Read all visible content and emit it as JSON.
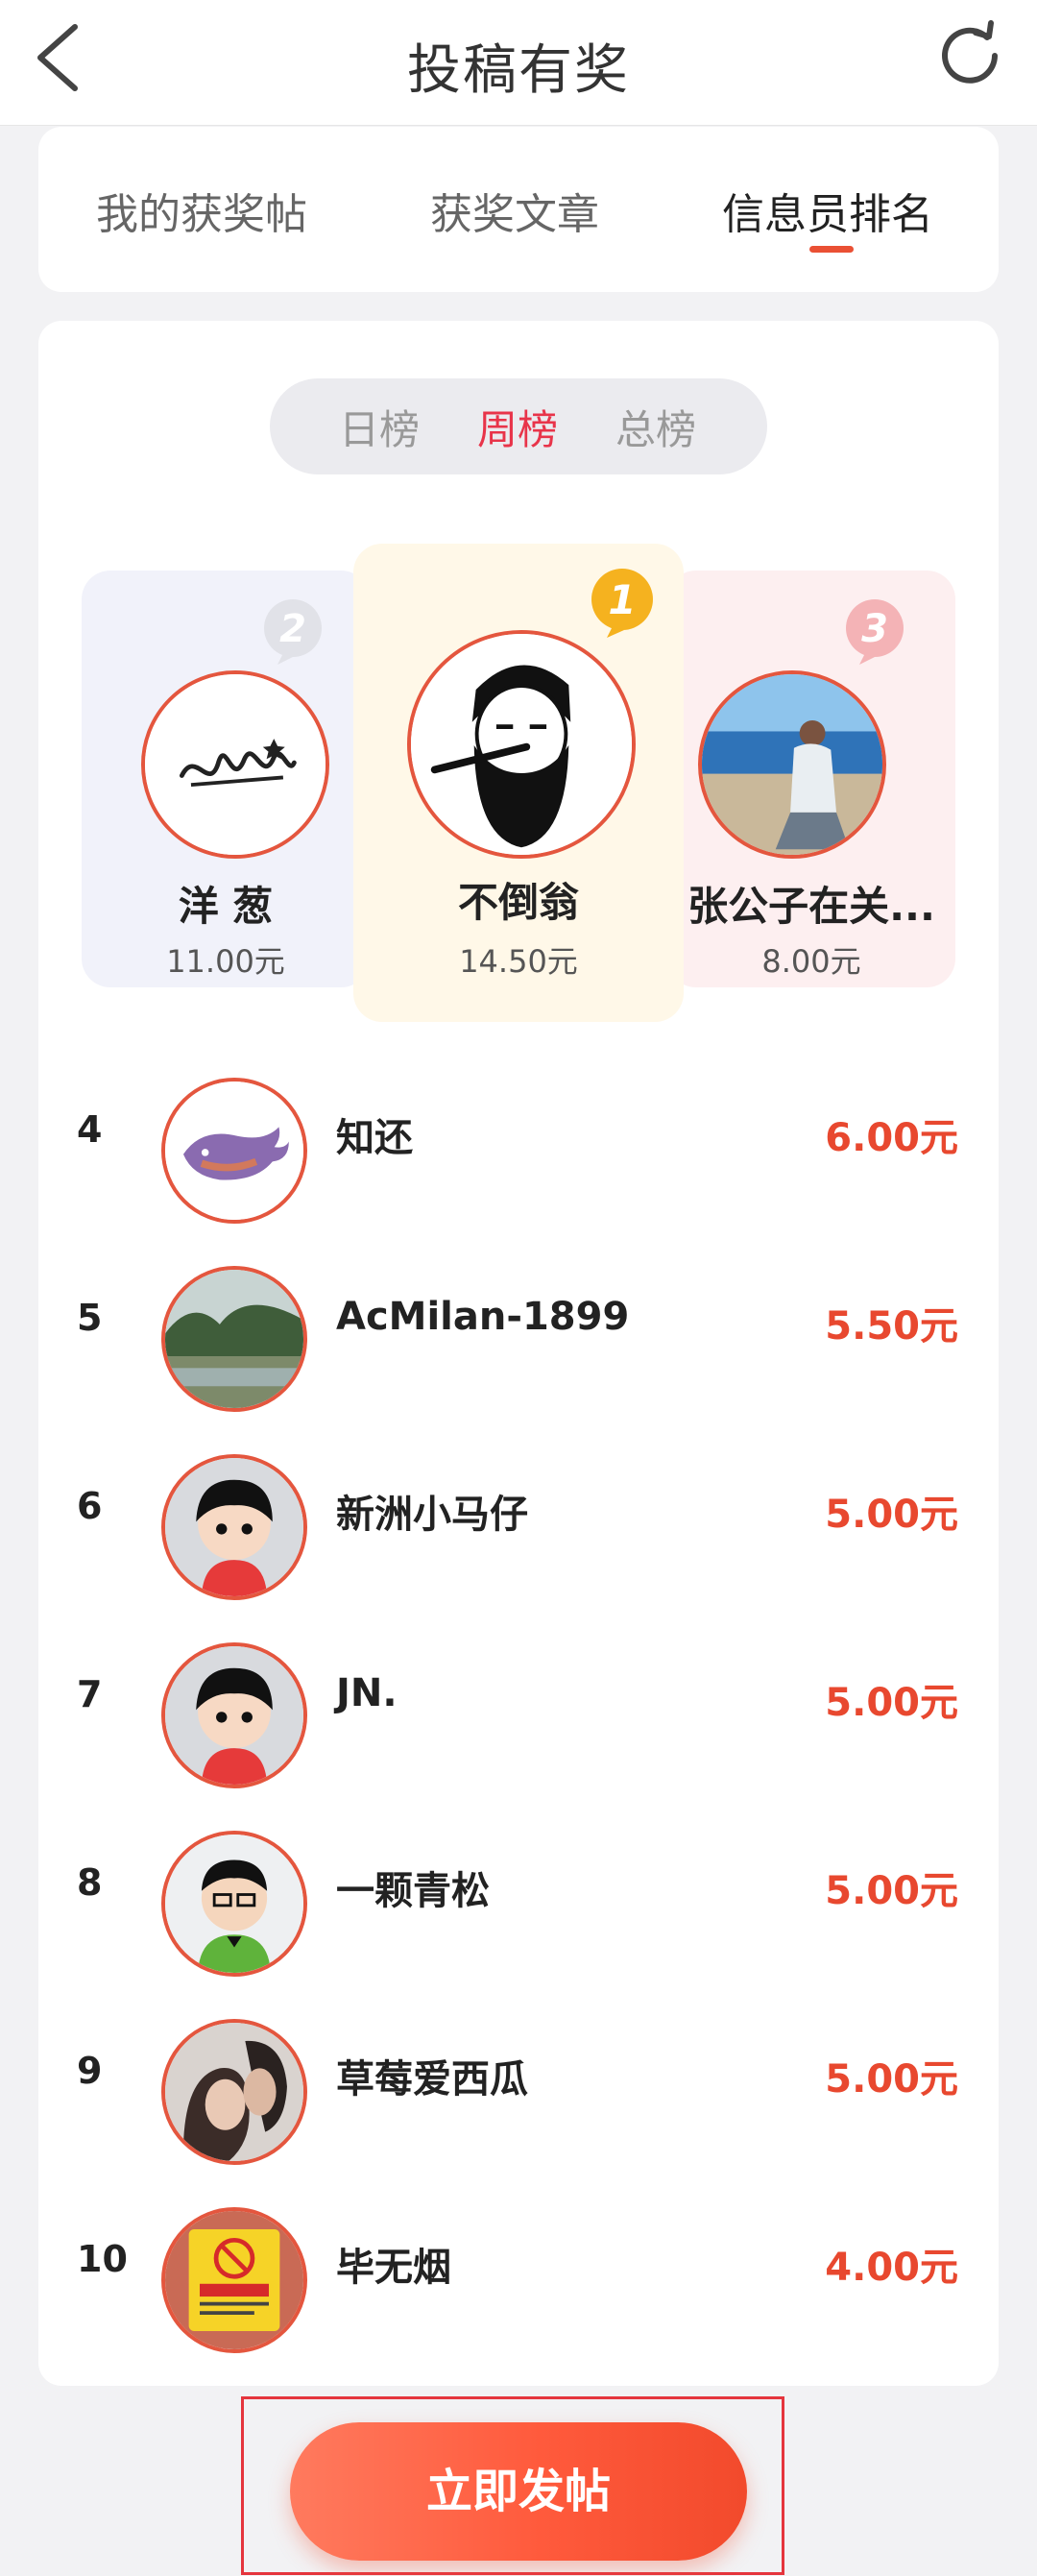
{
  "nav": {
    "title": "投稿有奖",
    "back_icon": "chevron-left-icon",
    "refresh_icon": "refresh-icon"
  },
  "tabs": [
    {
      "label": "我的获奖帖",
      "active": false
    },
    {
      "label": "获奖文章",
      "active": false
    },
    {
      "label": "信息员排名",
      "active": true
    }
  ],
  "period_tabs": [
    {
      "label": "日榜",
      "active": false
    },
    {
      "label": "周榜",
      "active": true
    },
    {
      "label": "总榜",
      "active": false
    }
  ],
  "podium": {
    "first": {
      "rank": "1",
      "name": "不倒翁",
      "amount": "14.50元"
    },
    "second": {
      "rank": "2",
      "name": "洋 葱",
      "amount": "11.00元"
    },
    "third": {
      "rank": "3",
      "name": "张公子在关...",
      "amount": "8.00元"
    }
  },
  "ranking": [
    {
      "rank": "4",
      "name": "知还",
      "amount": "6.00元"
    },
    {
      "rank": "5",
      "name": "AcMilan-1899",
      "amount": "5.50元"
    },
    {
      "rank": "6",
      "name": "新洲小马仔",
      "amount": "5.00元"
    },
    {
      "rank": "7",
      "name": "JN.",
      "amount": "5.00元"
    },
    {
      "rank": "8",
      "name": "一颗青松",
      "amount": "5.00元"
    },
    {
      "rank": "9",
      "name": "草莓爱西瓜",
      "amount": "5.00元"
    },
    {
      "rank": "10",
      "name": "毕无烟",
      "amount": "4.00元"
    }
  ],
  "post_button": {
    "label": "立即发帖"
  },
  "colors": {
    "accent": "#ea5034",
    "amount": "#e8482f",
    "active_period": "#e8344a",
    "gold": "#f5b21f"
  }
}
